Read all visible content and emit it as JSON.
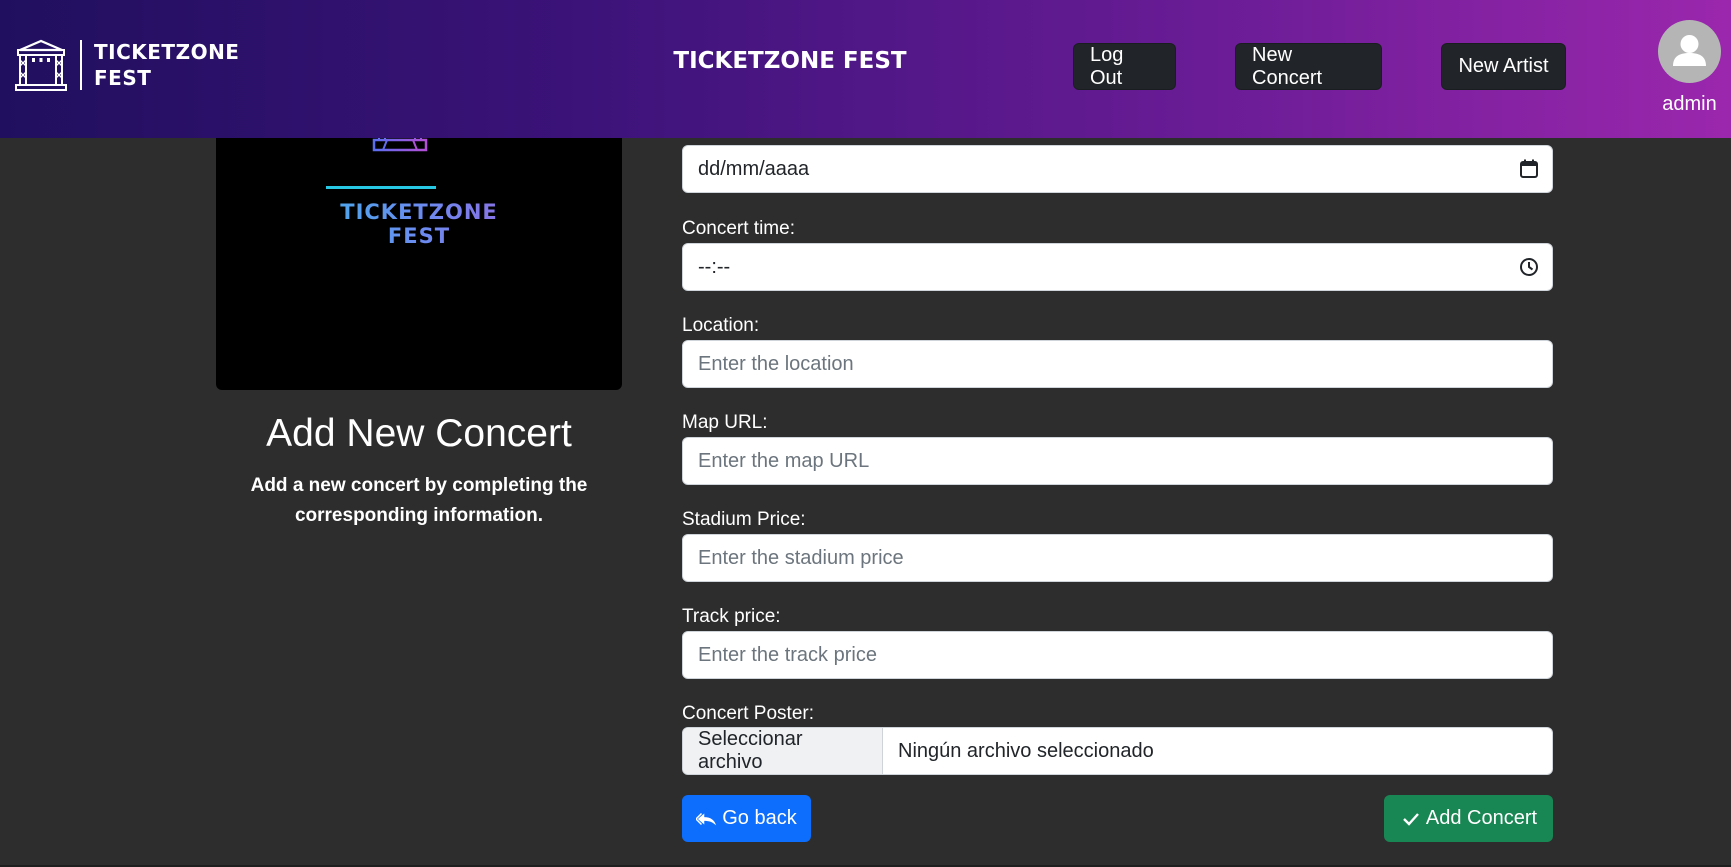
{
  "nav": {
    "brand_line1": "TICKETZONE",
    "brand_line2": "FEST",
    "center_title": "TICKETZONE FEST",
    "logout_label": "Log Out",
    "new_concert_label": "New Concert",
    "new_artist_label": "New Artist",
    "username": "admin"
  },
  "left": {
    "poster_line1": "TICKETZONE",
    "poster_line2": "FEST",
    "heading": "Add New Concert",
    "description": "Add a new concert by completing the corresponding information."
  },
  "form": {
    "date_value": "dd/mm/aaaa",
    "time_label": "Concert time:",
    "time_value": "--:--",
    "location_label": "Location:",
    "location_placeholder": "Enter the location",
    "map_label": "Map URL:",
    "map_placeholder": "Enter the map URL",
    "stadium_label": "Stadium Price:",
    "stadium_placeholder": "Enter the stadium price",
    "track_label": "Track price:",
    "track_placeholder": "Enter the track price",
    "poster_label": "Concert Poster:",
    "file_button_label": "Seleccionar archivo",
    "file_status": "Ningún archivo seleccionado"
  },
  "actions": {
    "go_back_label": "Go back",
    "add_concert_label": "Add Concert"
  },
  "colors": {
    "background": "#2d2d2d",
    "nav_gradient_start": "#200f5e",
    "nav_gradient_end": "#9b27ad",
    "primary": "#0d6efd",
    "success": "#198754",
    "dark_button": "#212529"
  },
  "icons": {
    "brand": "stage-icon",
    "avatar": "user-icon",
    "date": "calendar-icon",
    "time": "clock-icon",
    "go_back": "reply-all-icon",
    "add": "check-icon"
  }
}
